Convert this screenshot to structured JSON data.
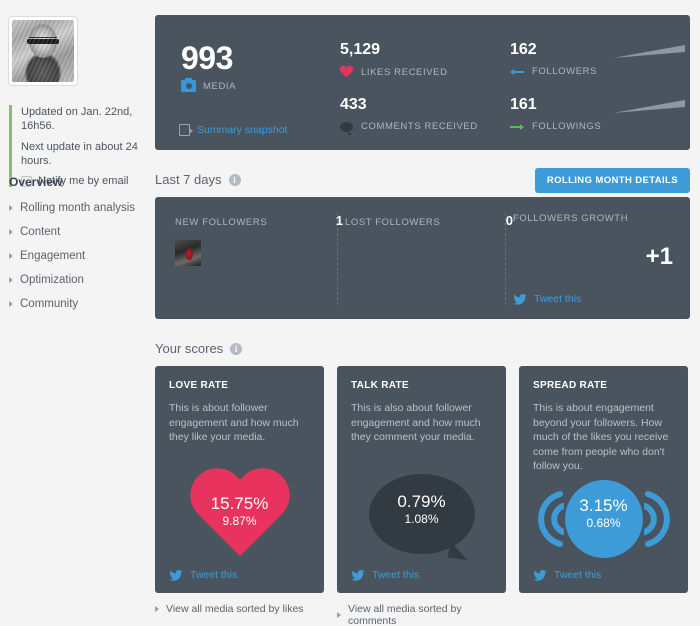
{
  "sidebar": {
    "avatar_alt": "profile-photo",
    "updated_text": "Updated on Jan. 22nd, 16h56.",
    "next_update_text": "Next update in about 24 hours.",
    "notify_label": "Notify me by email",
    "nav_title": "Overview",
    "nav_items": [
      {
        "label": "Rolling month analysis"
      },
      {
        "label": "Content"
      },
      {
        "label": "Engagement"
      },
      {
        "label": "Optimization"
      },
      {
        "label": "Community"
      }
    ]
  },
  "stats": {
    "media_value": "993",
    "media_label": "MEDIA",
    "likes_value": "5,129",
    "likes_label": "LIKES RECEIVED",
    "comments_value": "433",
    "comments_label": "COMMENTS RECEIVED",
    "followers_value": "162",
    "followers_label": "FOLLOWERS",
    "followings_value": "161",
    "followings_label": "FOLLOWINGS",
    "snapshot_link": "Summary snapshot"
  },
  "last7": {
    "section_title": "Last 7 days",
    "button_label": "ROLLING MONTH DETAILS",
    "new_followers_label": "NEW FOLLOWERS",
    "new_followers_value": "1",
    "lost_followers_label": "LOST FOLLOWERS",
    "lost_followers_value": "0",
    "growth_label": "FOLLOWERS GROWTH",
    "growth_value": "+1",
    "tweet_label": "Tweet this"
  },
  "scores": {
    "section_title": "Your scores",
    "cards": [
      {
        "title": "LOVE RATE",
        "description": "This is about follower engagement and how much they like your media.",
        "main_value": "15.75%",
        "sub_value": "9.87%",
        "tweet_label": "Tweet this",
        "under_link": "View all media sorted by likes",
        "color": "#e8335e"
      },
      {
        "title": "TALK RATE",
        "description": "This is also about follower engagement and how much they comment your media.",
        "main_value": "0.79%",
        "sub_value": "1.08%",
        "tweet_label": "Tweet this",
        "under_link": "View all media sorted by comments",
        "color": "#333b42"
      },
      {
        "title": "SPREAD RATE",
        "description": "This is about engagement beyond your followers. How much of the likes you receive come from people who don't follow you.",
        "main_value": "3.15%",
        "sub_value": "0.68%",
        "tweet_label": "Tweet this",
        "under_link": "",
        "color": "#3d9bd8"
      }
    ]
  },
  "theme": {
    "panel_bg": "#4a545e",
    "page_bg": "#f4f4f4",
    "accent_blue": "#3d9bd8",
    "accent_green": "#5cb85c",
    "accent_pink": "#e8335e"
  }
}
